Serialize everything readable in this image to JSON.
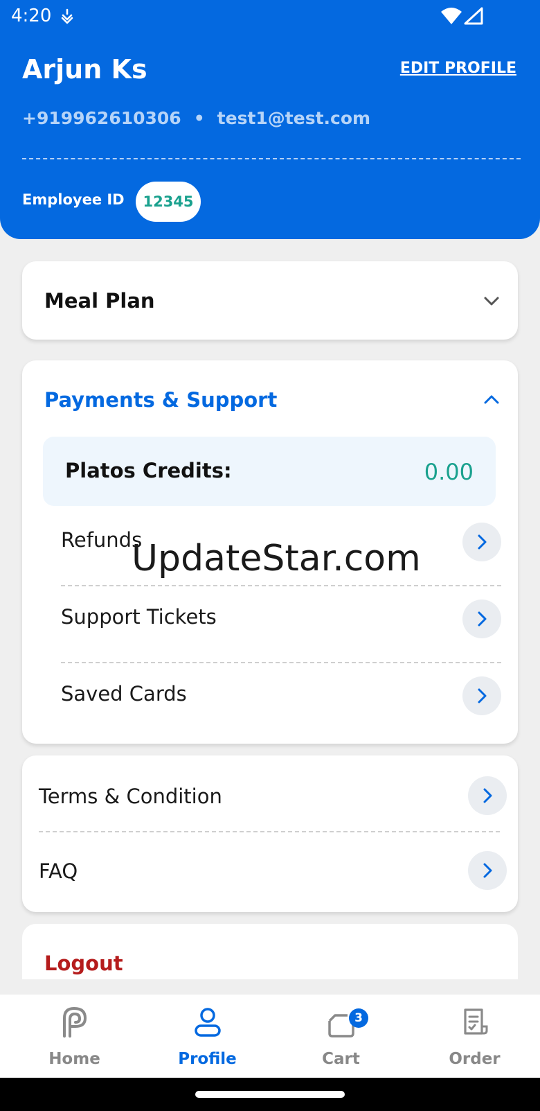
{
  "status": {
    "time": "4:20",
    "icons": [
      "notification-icon",
      "wifi-icon",
      "signal-icon"
    ]
  },
  "profile": {
    "name": "Arjun Ks",
    "edit_label": "EDIT PROFILE",
    "phone": "+919962610306",
    "separator": "•",
    "email": "test1@test.com",
    "employee_label": "Employee ID",
    "employee_id": "12345"
  },
  "meal_plan": {
    "title": "Meal Plan",
    "expanded": false
  },
  "payments": {
    "title": "Payments & Support",
    "expanded": true,
    "credits_label": "Platos Credits:",
    "credits_value": "0.00",
    "items": [
      {
        "label": "Refunds"
      },
      {
        "label": "Support Tickets"
      },
      {
        "label": "Saved Cards"
      }
    ]
  },
  "misc": {
    "items": [
      {
        "label": "Terms & Condition"
      },
      {
        "label": "FAQ"
      }
    ]
  },
  "logout_label": "Logout",
  "watermark": "UpdateStar.com",
  "bottom_nav": {
    "items": [
      {
        "label": "Home",
        "icon": "home-logo-icon",
        "active": false
      },
      {
        "label": "Profile",
        "icon": "user-icon",
        "active": true
      },
      {
        "label": "Cart",
        "icon": "cart-icon",
        "active": false,
        "badge": "3"
      },
      {
        "label": "Order",
        "icon": "order-receipt-icon",
        "active": false
      }
    ]
  },
  "colors": {
    "primary": "#0469e0",
    "teal": "#1aa18e",
    "danger": "#b51c1c",
    "background": "#efefef"
  }
}
